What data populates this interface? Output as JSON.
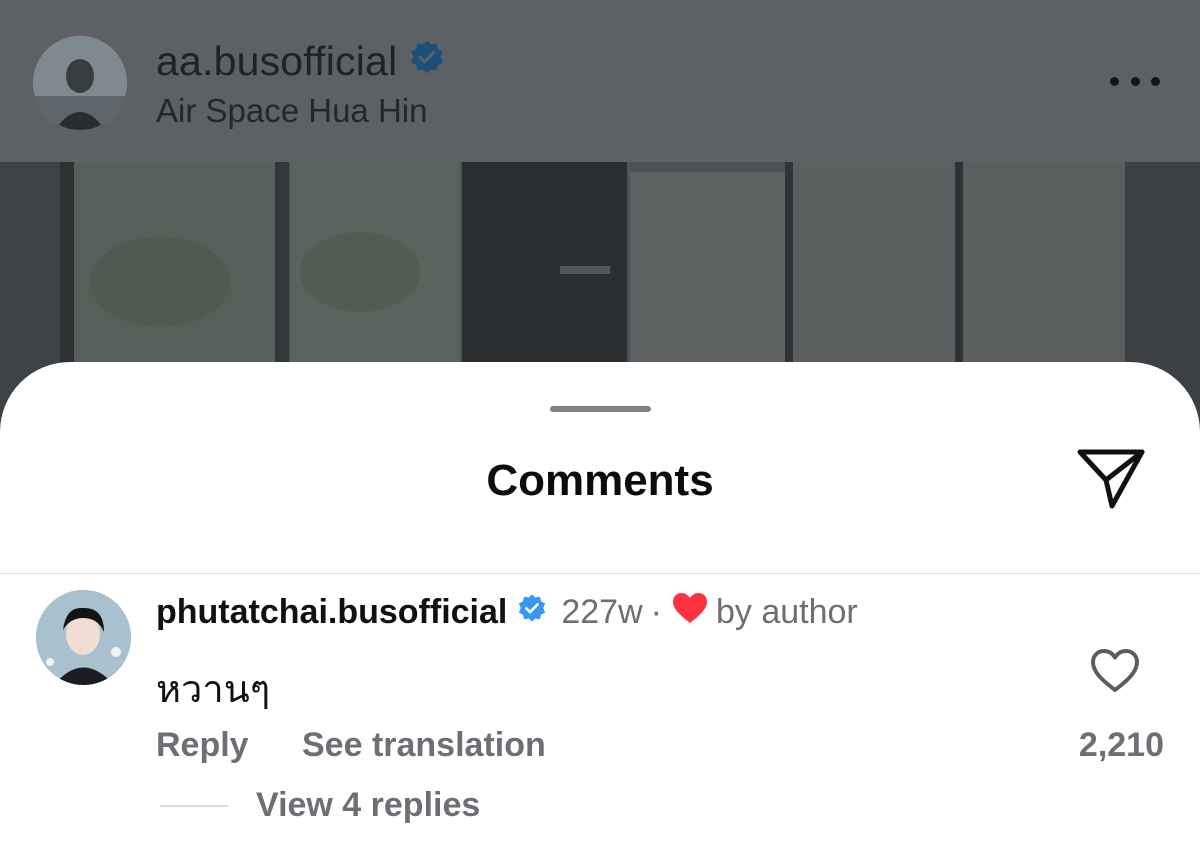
{
  "post": {
    "username": "aa.busofficial",
    "location": "Air Space Hua Hin"
  },
  "sheet": {
    "title": "Comments"
  },
  "comment": {
    "username": "phutatchai.busofficial",
    "time": "227w",
    "separator": "·",
    "liked_by": "by author",
    "text": "หวานๆ",
    "reply_label": "Reply",
    "translate_label": "See translation",
    "like_count": "2,210",
    "view_replies_label": "View 4 replies"
  },
  "colors": {
    "verified": "#3897f0",
    "heart": "#ff3040",
    "dim_overlay": "#5d6064",
    "secondary_text": "#6c6f73"
  },
  "icons": {
    "more": "more-horizontal-icon",
    "share": "paper-plane-icon",
    "verified": "verified-badge-icon",
    "like": "heart-outline-icon",
    "liked_by_author": "heart-filled-icon"
  }
}
